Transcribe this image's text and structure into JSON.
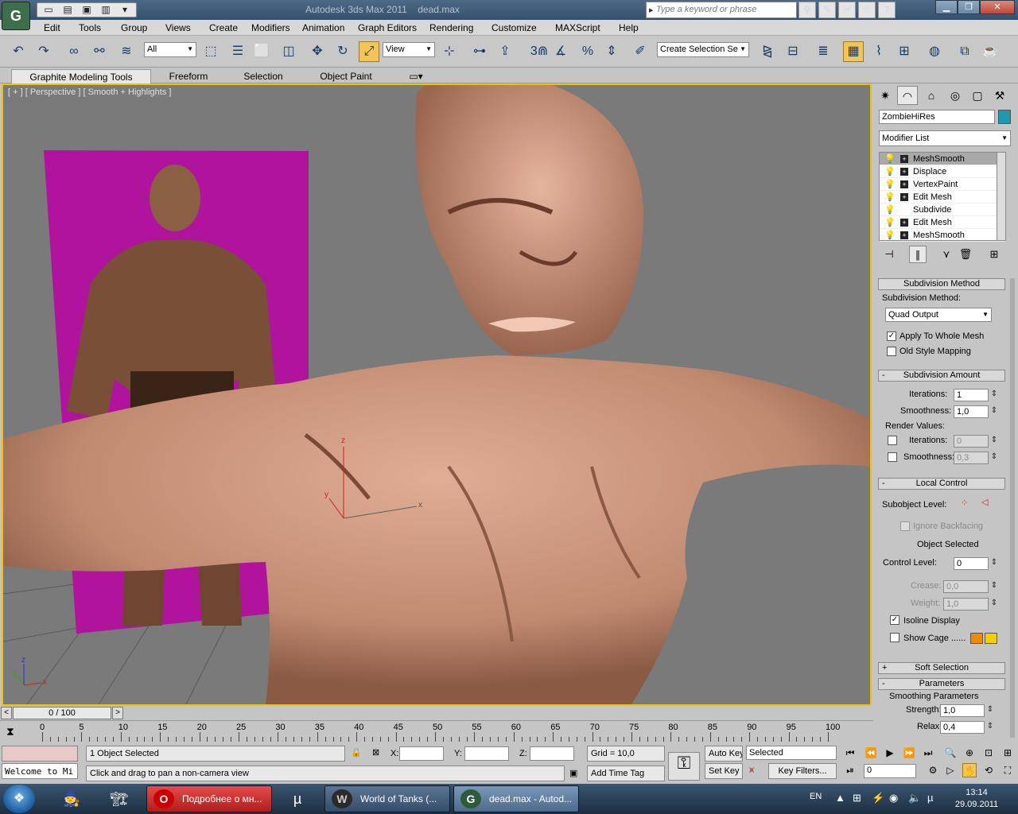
{
  "titlebar": {
    "app_title": "Autodesk 3ds Max  2011",
    "file_name": "dead.max",
    "search_placeholder": "Type a keyword or phrase"
  },
  "menu": [
    "Edit",
    "Tools",
    "Group",
    "Views",
    "Create",
    "Modifiers",
    "Animation",
    "Graph Editors",
    "Rendering",
    "Customize",
    "MAXScript",
    "Help"
  ],
  "toolbar": {
    "selection_filter": "All",
    "ref_coord": "View",
    "snap_label": "3",
    "named_selection_placeholder": "Create Selection Se"
  },
  "ribbon": {
    "tabs": [
      "Graphite Modeling Tools",
      "Freeform",
      "Selection",
      "Object Paint"
    ]
  },
  "viewport": {
    "label": "[ + ] [ Perspective ] [ Smooth + Highlights ]",
    "gizmo_x": "x",
    "gizmo_y": "y",
    "gizmo_z": "z",
    "backdrop_color": "#b0149c",
    "skin_color": "#d09a82"
  },
  "command_panel": {
    "object_name": "ZombieHiRes",
    "object_color": "#1a9bb0",
    "modifier_list": "Modifier List",
    "stack": [
      "MeshSmooth",
      "Displace",
      "VertexPaint",
      "Edit Mesh",
      "Subdivide",
      "Edit Mesh",
      "MeshSmooth"
    ],
    "rollouts": {
      "subdivision_method_header": "Subdivision Method",
      "subdivision_method_label": "Subdivision Method:",
      "subdivision_method_value": "Quad Output",
      "apply_whole_mesh": "Apply To Whole Mesh",
      "old_style_mapping": "Old Style Mapping",
      "subdivision_amount_header": "Subdivision Amount",
      "iterations_label": "Iterations:",
      "iterations_value": "1",
      "smoothness_label": "Smoothness:",
      "smoothness_value": "1,0",
      "render_values_label": "Render Values:",
      "render_iterations_label": "Iterations:",
      "render_iterations_value": "0",
      "render_smoothness_label": "Smoothness:",
      "render_smoothness_value": "0,3",
      "local_control_header": "Local Control",
      "subobject_level_label": "Subobject Level:",
      "ignore_backfacing": "Ignore Backfacing",
      "object_selected": "Object Selected",
      "control_level_label": "Control Level:",
      "control_level_value": "0",
      "crease_label": "Crease:",
      "crease_value": "0,0",
      "weight_label": "Weight:",
      "weight_value": "1,0",
      "isoline_display": "Isoline Display",
      "show_cage": "Show Cage ......",
      "cage_color_1": "#f08a00",
      "cage_color_2": "#f0d000",
      "soft_selection_header": "Soft Selection",
      "parameters_header": "Parameters",
      "smoothing_params_label": "Smoothing Parameters",
      "strength_label": "Strength:",
      "strength_value": "1,0",
      "relax_label": "Relax:",
      "relax_value": "0,4"
    }
  },
  "timeline": {
    "frame_display": "0 / 100",
    "ticks": [
      "0",
      "5",
      "10",
      "15",
      "20",
      "25",
      "30",
      "35",
      "40",
      "45",
      "50",
      "55",
      "60",
      "65",
      "70",
      "75",
      "80",
      "85",
      "90",
      "95",
      "100"
    ]
  },
  "status": {
    "maxscript_listener": "Welcome to Mi",
    "selection_info": "1 Object Selected",
    "prompt": "Click and drag to pan a non-camera view",
    "x_label": "X:",
    "y_label": "Y:",
    "z_label": "Z:",
    "grid": "Grid = 10,0",
    "add_time_tag": "Add Time Tag",
    "auto_key": "Auto Key",
    "set_key": "Set Key",
    "key_mode": "Selected",
    "key_filters": "Key Filters...",
    "current_frame": "0"
  },
  "taskbar": {
    "items": [
      {
        "label": "Подробнее о мн...",
        "icon": "O"
      },
      {
        "label": "World of Tanks (...",
        "icon": "W"
      },
      {
        "label": "dead.max - Autod...",
        "icon": "G"
      }
    ],
    "language": "EN",
    "time": "13:14",
    "date": "29.09.2011"
  }
}
